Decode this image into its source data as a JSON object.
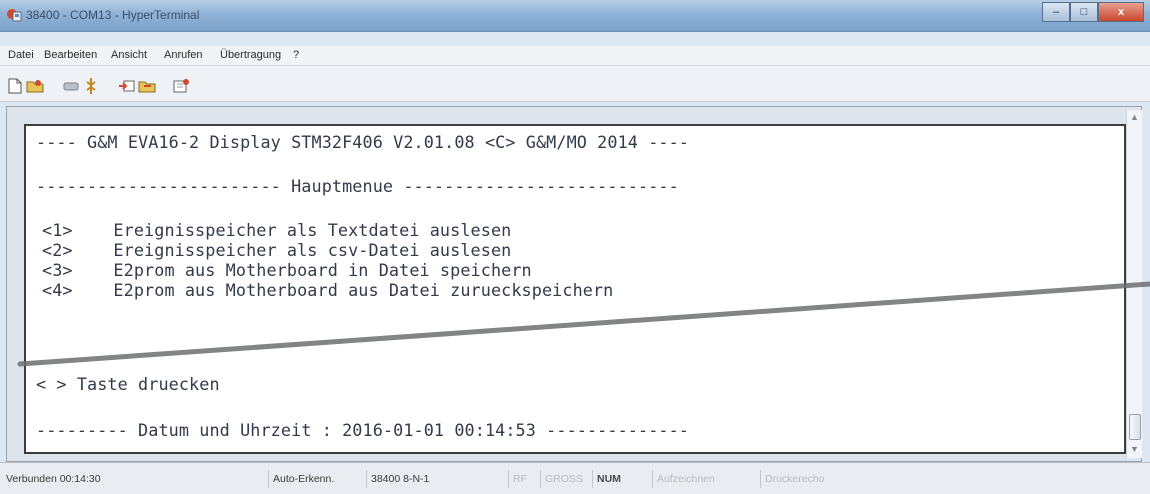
{
  "window": {
    "title": "38400 - COM13 - HyperTerminal",
    "buttons": {
      "minimize": "–",
      "maximize": "□",
      "close": "x"
    }
  },
  "menu": [
    {
      "label": "Datei"
    },
    {
      "label": "Bearbeiten"
    },
    {
      "label": "Ansicht"
    },
    {
      "label": "Anrufen"
    },
    {
      "label": "Übertragung"
    },
    {
      "label": "?"
    }
  ],
  "toolbar": [
    {
      "icon": "new-document-icon"
    },
    {
      "icon": "open-folder-icon"
    },
    {
      "icon": "phone-icon"
    },
    {
      "icon": "disconnect-icon"
    },
    {
      "icon": "send-file-icon"
    },
    {
      "icon": "receive-file-icon"
    },
    {
      "icon": "properties-icon"
    }
  ],
  "terminal": {
    "lines": [
      "---- G&M EVA16-2 Display STM32F406 V2.01.08 <C> G&M/MO 2014 ----",
      "------------------------ Hauptmenue ---------------------------",
      "<1>    Ereignisspeicher als Textdatei auslesen",
      "<2>    Ereignisspeicher als csv-Datei auslesen",
      "<3>    E2prom aus Motherboard in Datei speichern",
      "<4>    E2prom aus Motherboard aus Datei zurueckspeichern",
      "< > Taste druecken",
      "--------- Datum und Uhrzeit : 2016-01-01 00:14:53 --------------"
    ],
    "text_color": "#333a49",
    "background": "#ffffff"
  },
  "statusbar": [
    {
      "label": "Verbunden 00:14:30",
      "active": true
    },
    {
      "label": "Auto-Erkenn.",
      "active": true
    },
    {
      "label": "38400 8-N-1",
      "active": true
    },
    {
      "label": "RF",
      "active": false
    },
    {
      "label": "GROSS",
      "active": false
    },
    {
      "label": "NUM",
      "active": true
    },
    {
      "label": "Aufzeichnen",
      "active": false
    },
    {
      "label": "Druckerecho",
      "active": false
    }
  ],
  "colors": {
    "titlebar": "#8fb1d6",
    "close_button": "#c9472d",
    "inactive_status": "#b7bcc3"
  }
}
